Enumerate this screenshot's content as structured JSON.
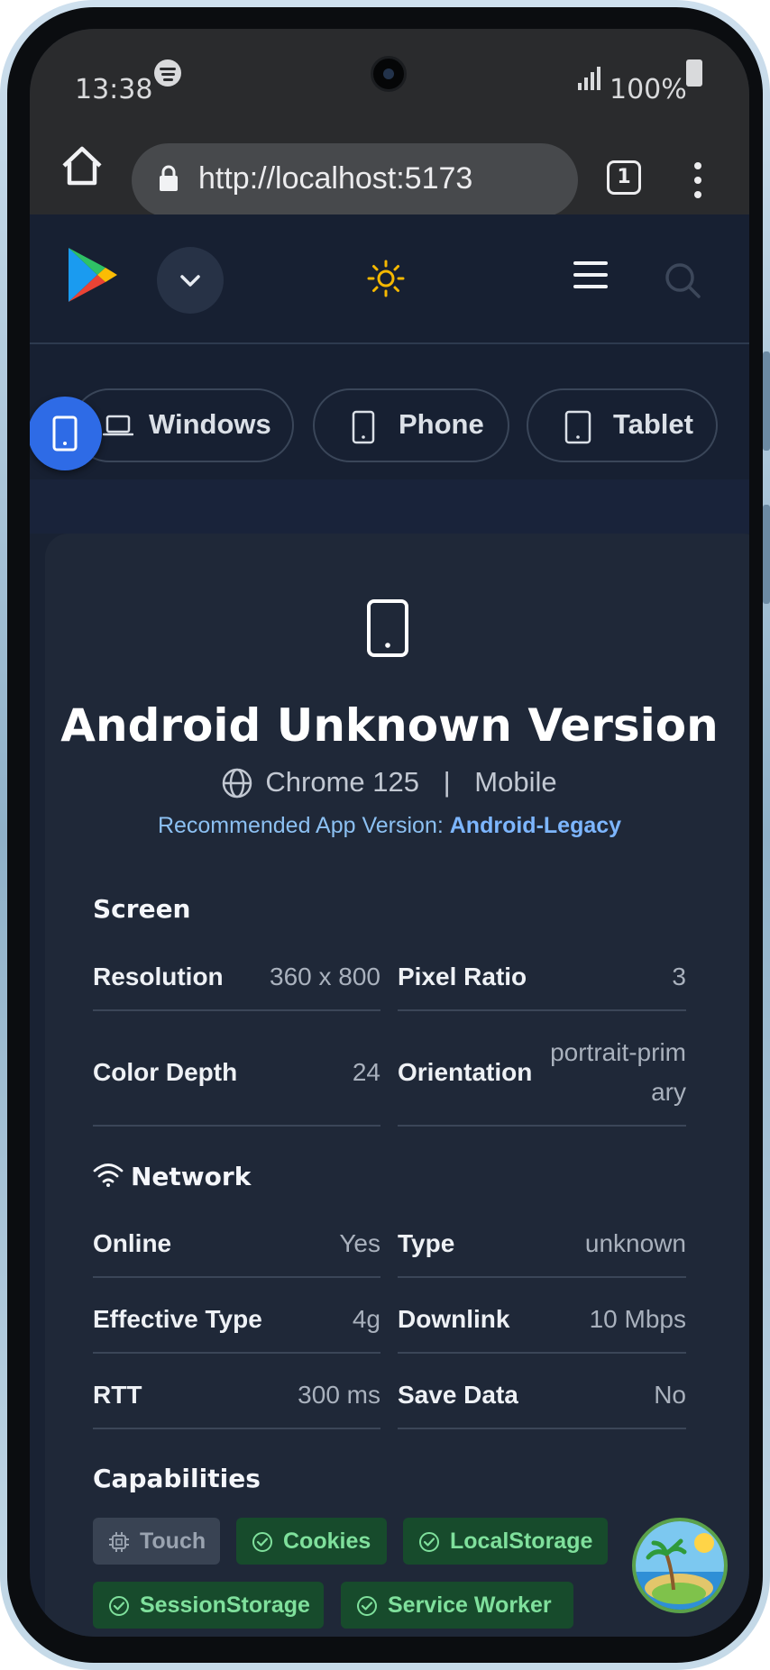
{
  "status_bar": {
    "time": "13:38",
    "battery": "100%"
  },
  "browser": {
    "url": "http://localhost:5173",
    "tab_count": "1"
  },
  "platform_tabs": [
    {
      "label": "Windows",
      "icon": "laptop-icon"
    },
    {
      "label": "Phone",
      "icon": "phone-icon"
    },
    {
      "label": "Tablet",
      "icon": "tablet-icon"
    }
  ],
  "device": {
    "title": "Android Unknown Version",
    "browser": "Chrome 125",
    "separator": "|",
    "form_factor": "Mobile",
    "recommended_label": "Recommended App Version:",
    "recommended_value": "Android-Legacy"
  },
  "screen": {
    "heading": "Screen",
    "rows": [
      {
        "key": "Resolution",
        "value": "360 x 800"
      },
      {
        "key": "Pixel Ratio",
        "value": "3"
      },
      {
        "key": "Color Depth",
        "value": "24"
      },
      {
        "key": "Orientation",
        "value": "portrait-primary",
        "value_line1": "portrait-prim",
        "value_line2": "ary"
      }
    ]
  },
  "network": {
    "heading": "Network",
    "rows": [
      {
        "key": "Online",
        "value": "Yes"
      },
      {
        "key": "Type",
        "value": "unknown"
      },
      {
        "key": "Effective Type",
        "value": "4g"
      },
      {
        "key": "Downlink",
        "value": "10 Mbps"
      },
      {
        "key": "RTT",
        "value": "300 ms"
      },
      {
        "key": "Save Data",
        "value": "No"
      }
    ]
  },
  "capabilities": {
    "heading": "Capabilities",
    "items": [
      {
        "label": "Touch",
        "enabled": false
      },
      {
        "label": "Cookies",
        "enabled": true
      },
      {
        "label": "LocalStorage",
        "enabled": true
      },
      {
        "label": "SessionStorage",
        "enabled": true
      },
      {
        "label": "Service Worker",
        "enabled": true
      }
    ]
  },
  "colors": {
    "accent": "#2e6be6",
    "enabled_chip": "#174b2c",
    "disabled_chip": "#394353",
    "sun": "#f5b800"
  }
}
